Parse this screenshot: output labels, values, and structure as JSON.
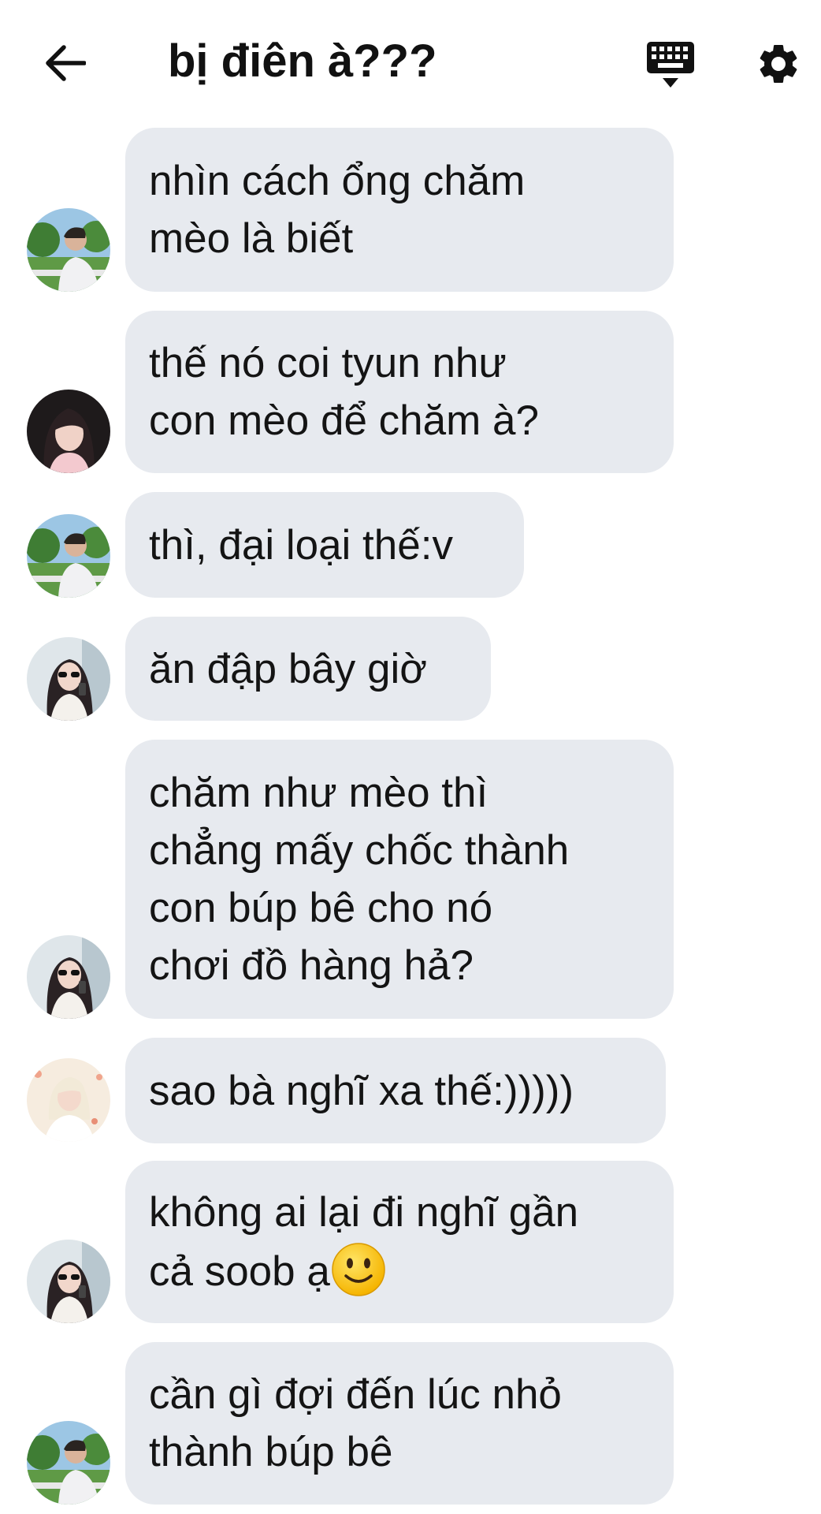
{
  "header": {
    "back_icon": "arrow-left-icon",
    "title": "bị điên à???",
    "keyboard_icon": "keyboard-icon",
    "settings_icon": "gear-icon"
  },
  "colors": {
    "bubble_bg": "#e7eaef",
    "text": "#141414",
    "background": "#ffffff"
  },
  "messages": [
    {
      "sender": "boy-garden",
      "text": "nhìn cách ổng chăm\nmèo là biết"
    },
    {
      "sender": "girl-dark-hair",
      "text": "thế nó coi tyun như\ncon mèo để chăm à?"
    },
    {
      "sender": "boy-garden",
      "text": "thì, đại loại thế:v"
    },
    {
      "sender": "girl-sunglasses",
      "text": "ăn đập bây giờ"
    },
    {
      "sender": "girl-sunglasses",
      "text": "chăm như mèo thì\nchẳng mấy chốc thành\ncon búp bê cho nó\nchơi đồ hàng hả?"
    },
    {
      "sender": "blonde-girl",
      "text": "sao bà nghĩ xa thế:)))))"
    },
    {
      "sender": "girl-sunglasses",
      "text": "không ai lại đi nghĩ gần\ncả soob ạ",
      "emoji": "slightly-smiling-face-icon"
    },
    {
      "sender": "boy-garden",
      "text": "cần gì đợi đến lúc nhỏ\nthành búp bê"
    }
  ]
}
